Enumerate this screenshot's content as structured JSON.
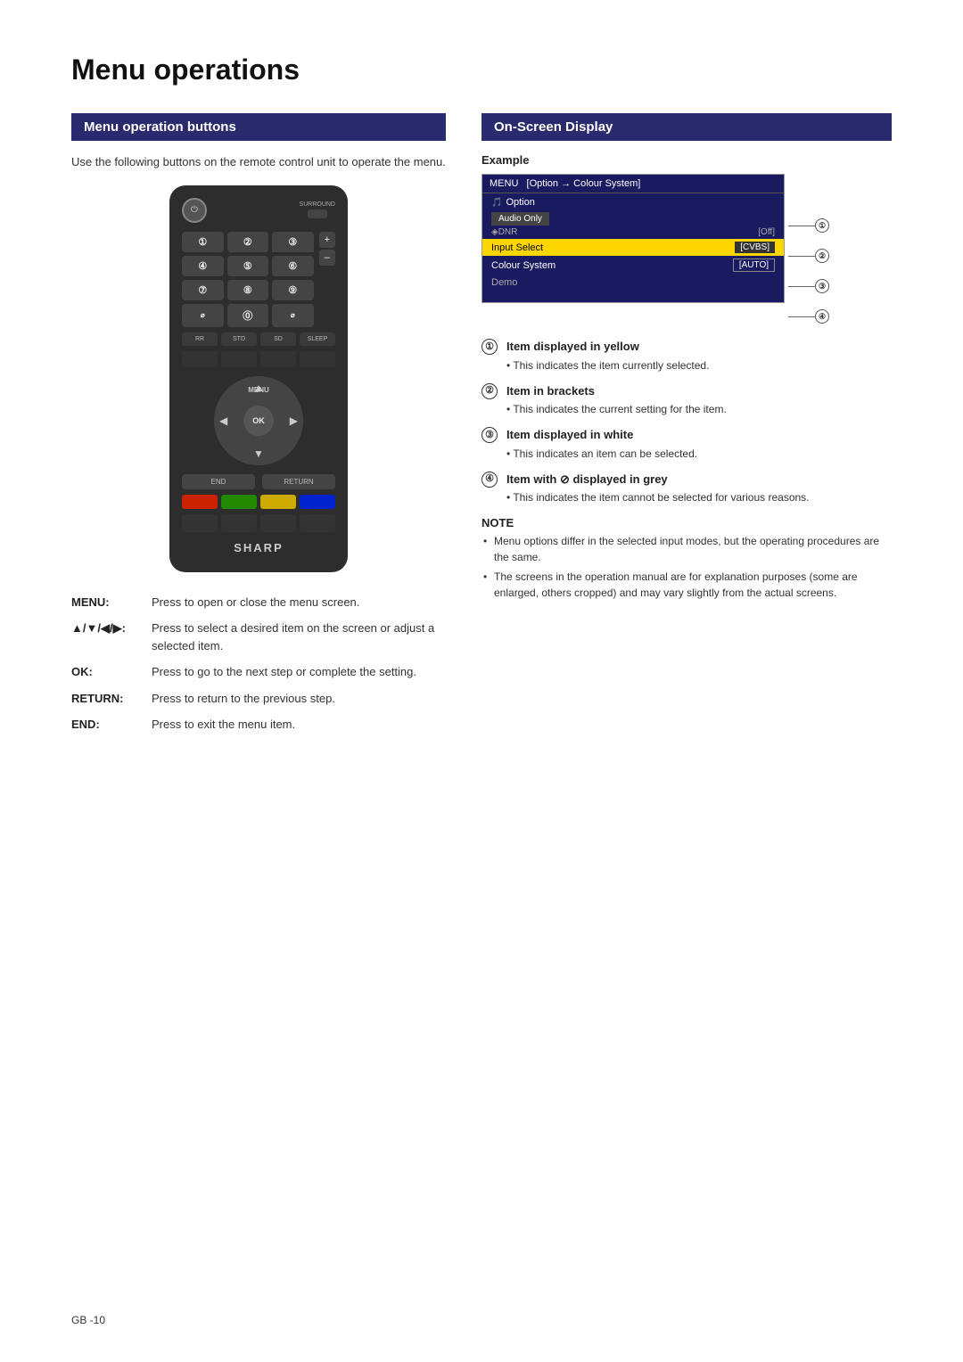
{
  "page": {
    "title": "Menu operations",
    "footer": "GB -10"
  },
  "left_section": {
    "header": "Menu operation buttons",
    "intro": "Use the following buttons on the remote control unit to operate the menu.",
    "remote": {
      "brand": "SHARP",
      "power_symbol": "⏻",
      "surround_label": "SURROUND",
      "ok_label": "OK",
      "menu_label": "MENU",
      "numbers": [
        "1",
        "2",
        "3",
        "4",
        "5",
        "6",
        "7",
        "8",
        "9",
        "⌀",
        "0",
        "⌀"
      ],
      "vol_plus": "+",
      "vol_minus": "–",
      "func_labels": [
        "RR",
        "STD",
        "SD",
        "SLEEP"
      ],
      "end_label": "END",
      "return_label": "RETURN",
      "color_btns": [
        "red",
        "green",
        "yellow",
        "blue"
      ]
    },
    "key_descriptions": [
      {
        "key": "MENU:",
        "desc": "Press to open or close the menu screen."
      },
      {
        "key": "▲/▼/◀/▶:",
        "desc": "Press to select a desired item on the screen or adjust a selected item."
      },
      {
        "key": "OK:",
        "desc": "Press to go to the next step or complete the setting."
      },
      {
        "key": "RETURN:",
        "desc": "Press to return to the previous step."
      },
      {
        "key": "END:",
        "desc": "Press to exit the menu item."
      }
    ]
  },
  "right_section": {
    "header": "On-Screen Display",
    "example_label": "Example",
    "osd": {
      "header_text": "MENU   [Option → Colour System]",
      "menu_icon": "🎵",
      "menu_item": "Option",
      "audio_only": "Audio Only",
      "dnr_label": "◈DNR",
      "off_label": "[Off]",
      "input_select": "Input Select",
      "input_value": "[CVBS]",
      "colour_system": "Colour System",
      "colour_value": "[AUTO]",
      "demo": "Demo"
    },
    "annotations": [
      {
        "num": "①",
        "title": "Item displayed in yellow",
        "bullet": "This indicates the item currently selected."
      },
      {
        "num": "②",
        "title": "Item in brackets",
        "bullet": "This indicates the current setting for the item."
      },
      {
        "num": "③",
        "title": "Item displayed in white",
        "bullet": "This indicates an item can be selected."
      },
      {
        "num": "④",
        "title": "Item with ⊘ displayed in grey",
        "bullet": "This indicates the item cannot be selected for various reasons."
      }
    ],
    "notes": [
      "Menu options differ in the selected input modes, but the operating procedures are the same.",
      "The screens in the operation manual are for explanation purposes (some are enlarged, others cropped) and may vary slightly from the actual screens."
    ]
  }
}
